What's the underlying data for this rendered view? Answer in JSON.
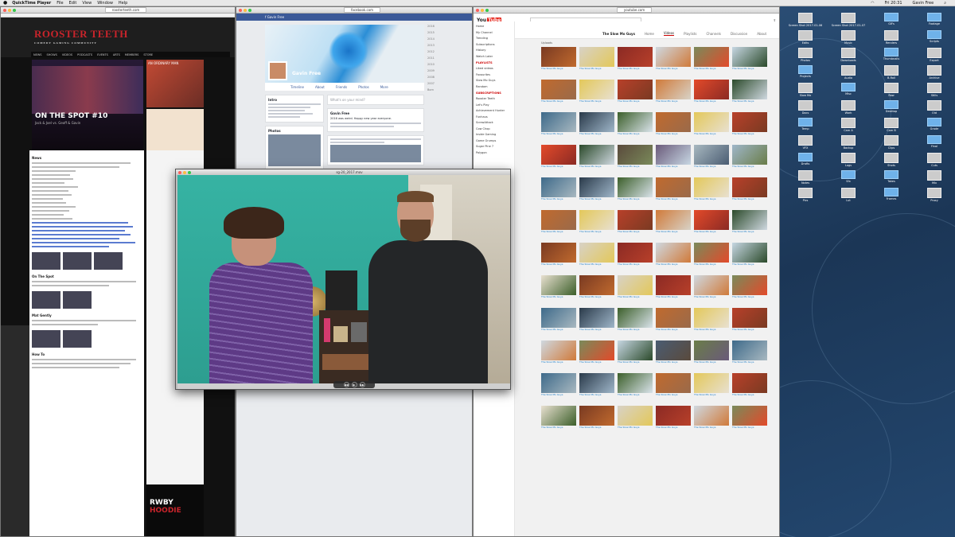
{
  "menubar": {
    "app": "QuickTime Player",
    "items": [
      "File",
      "Edit",
      "View",
      "Window",
      "Help"
    ],
    "clock": "Fri 20:31",
    "user": "Gavin Free"
  },
  "rt": {
    "url": "roosterteeth.com",
    "logo": "ROOSTER TEETH",
    "tagline": "COMEDY GAMING COMMUNITY",
    "nav": [
      "NEWS",
      "SHOWS",
      "VIDEOS",
      "PODCASTS",
      "EVENTS",
      "ARTS",
      "MEMBERS",
      "STORE"
    ],
    "hero_title": "ON THE SPOT #10",
    "hero_sub": "Jack & Joel vs. Geoff & Gavin",
    "ad_text": "AN ORDINARY MAN",
    "news_heading": "News",
    "post_title": "On The Spot",
    "post2_title": "Mat Gently",
    "post3_title": "How To",
    "rwby_line1": "RWBY",
    "rwby_line2": "HOODIE"
  },
  "fb": {
    "url": "facebook.com",
    "profile_name": "Gavin Free",
    "tabs": [
      "Timeline",
      "About",
      "Friends",
      "Photos",
      "More"
    ],
    "composer": "What's on your mind?",
    "post_author": "Gavin Free",
    "post_text": "2016 was weird. Happy new year everyone.",
    "years": [
      "2016",
      "2015",
      "2014",
      "2013",
      "2012",
      "2011",
      "2010",
      "2009",
      "2008",
      "2007",
      "Born"
    ],
    "sections": [
      "Intro",
      "Photos",
      "Friends"
    ]
  },
  "yt": {
    "url": "youtube.com",
    "channel": "The Slow Mo Guys",
    "channel_tabs": [
      "Home",
      "Videos",
      "Playlists",
      "Channels",
      "Discussion",
      "About"
    ],
    "sort_label": "Uploads",
    "sidebar_top": [
      "Home",
      "My Channel",
      "Trending",
      "Subscriptions",
      "History",
      "Watch Later"
    ],
    "playlists_heading": "PLAYLISTS",
    "playlists": [
      "Liked videos",
      "Favourites",
      "Slow Mo Guys",
      "Random"
    ],
    "subscriptions_heading": "SUBSCRIPTIONS",
    "subscriptions": [
      "Rooster Teeth",
      "Let's Play",
      "Achievement Hunter",
      "Funhaus",
      "ScrewAttack",
      "Cow Chop",
      "Inside Gaming",
      "Game Grumps",
      "Sugar Pine 7",
      "Polygon"
    ],
    "video_caption": "The Slow Mo Guys",
    "video_colors": [
      "#7a3a22",
      "#c7d7e3",
      "#3c5f2a",
      "#e34a2a",
      "#9fb6c9",
      "#d8d2c6",
      "#4a5c72",
      "#c06a2e",
      "#2b4a2a",
      "#d9e3ea",
      "#8b2a24",
      "#6a7d48",
      "#e3c85a",
      "#5a4a3c",
      "#9a6a4a",
      "#cfd8e0",
      "#3e6a8a",
      "#b8402a",
      "#6a5a7a",
      "#e8e0d0",
      "#7a8a5a",
      "#2a3a4a",
      "#d07a3a",
      "#a8b8c0"
    ]
  },
  "quicktime": {
    "title": "sg-20_2017.mov",
    "controls": [
      "◀◀",
      "▶",
      "▶▶"
    ]
  },
  "desktop": {
    "icons": [
      "Screen Shot 2017-01-06",
      "Screen Shot 2017-01-07",
      "GIFs",
      "Footage",
      "Edits",
      "Music",
      "Renders",
      "Scripts",
      "Photos",
      "Downloads",
      "Thumbnails",
      "Export",
      "Projects",
      "Audio",
      "B-Roll",
      "Archive",
      "Slow Mo",
      "Misc",
      "Raw",
      "Stills",
      "Docs",
      "Work",
      "Desktop",
      "Old",
      "Temp",
      "Cam A",
      "Cam B",
      "Grade",
      "VFX",
      "Backup",
      "Clips",
      "Final",
      "Drafts",
      "Logs",
      "Shots",
      "Cuts",
      "Notes",
      "Sfx",
      "Takes",
      "Mix",
      "Pics",
      "Lut",
      "Frames",
      "Proxy"
    ]
  }
}
